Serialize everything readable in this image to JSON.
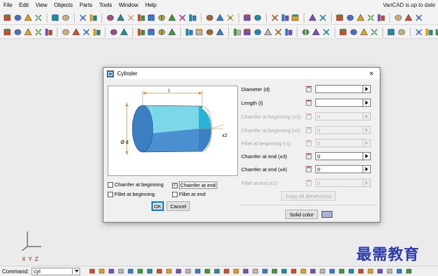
{
  "app": {
    "menu": [
      "File",
      "Edit",
      "View",
      "Objects",
      "Parts",
      "Tools",
      "Window",
      "Help"
    ],
    "update_status": "VariCAD is up to date"
  },
  "drawing": {
    "axis_label": "X Y Z"
  },
  "command_bar": {
    "label": "Command:",
    "value": "cyl"
  },
  "watermark": "最需教育",
  "dialog": {
    "title": "Cylinder",
    "close_symbol": "×",
    "illustration": {
      "labels": {
        "length": "l",
        "diameter": "Ø d",
        "chamfer_end": "x2"
      },
      "colors": {
        "body": "#4a90d0",
        "top": "#7ad8e8",
        "chamfer": "#2ab3d6"
      }
    },
    "options": [
      {
        "label": "Chamfer at beginning",
        "checked": false
      },
      {
        "label": "Chamfer at end",
        "checked": true
      },
      {
        "label": "Fillet at beginning",
        "checked": false
      },
      {
        "label": "Fillet at end",
        "checked": false
      }
    ],
    "ok_label": "OK",
    "cancel_label": "Cancel",
    "fields": [
      {
        "label": "Diameter (d)",
        "value": "",
        "enabled": true
      },
      {
        "label": "Length (l)",
        "value": "",
        "enabled": true
      },
      {
        "label": "Chamfer at beginning (x1)",
        "value": "0",
        "enabled": false
      },
      {
        "label": "Chamfer at beginning (x2)",
        "value": "0",
        "enabled": false
      },
      {
        "label": "Fillet at beginning (r1)",
        "value": "0",
        "enabled": false
      },
      {
        "label": "Chamfer at end (x3)",
        "value": "0",
        "enabled": true
      },
      {
        "label": "Chamfer at end (x4)",
        "value": "0",
        "enabled": true
      },
      {
        "label": "Fillet at end (r2)",
        "value": "0",
        "enabled": false
      }
    ],
    "copy_all_label": "Copy all dimensions",
    "solid_color_label": "Solid color",
    "solid_color": "#a8b4d8"
  },
  "colors": {
    "accent": "#0078d7",
    "watermark": "#2a3ab0"
  }
}
